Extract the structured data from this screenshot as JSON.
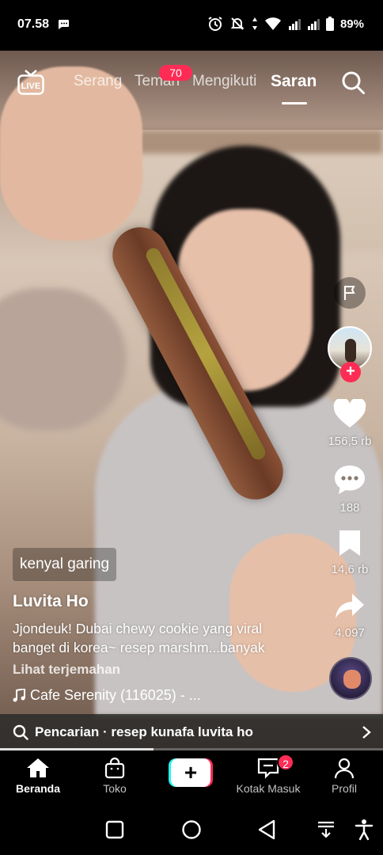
{
  "status_bar": {
    "time": "07.58",
    "battery": "89%"
  },
  "top_nav": {
    "live_label": "LIVE",
    "tabs": [
      {
        "label": "Serang"
      },
      {
        "label": "Teman",
        "badge": "70"
      },
      {
        "label": "Mengikuti"
      },
      {
        "label": "Saran",
        "active": true
      }
    ]
  },
  "actions": {
    "likes": "156,5 rb",
    "comments": "188",
    "saves": "14,6 rb",
    "shares": "4.097"
  },
  "video": {
    "sticker": "kenyal garing",
    "author": "Luvita Ho",
    "description": "Jjondeuk! Dubai chewy cookie yang viral banget di korea~ resep marshm...banyak",
    "translate": "Lihat terjemahan",
    "music": "Cafe Serenity (116025) - ...",
    "progress": 0.4
  },
  "search_suggestion": {
    "text": "Pencarian · resep kunafa luvita ho"
  },
  "tab_bar": {
    "home": "Beranda",
    "shop": "Toko",
    "inbox": "Kotak Masuk",
    "inbox_badge": "2",
    "profile": "Profil"
  },
  "colors": {
    "accent": "#fe2c55",
    "cyan": "#25f4ee"
  }
}
